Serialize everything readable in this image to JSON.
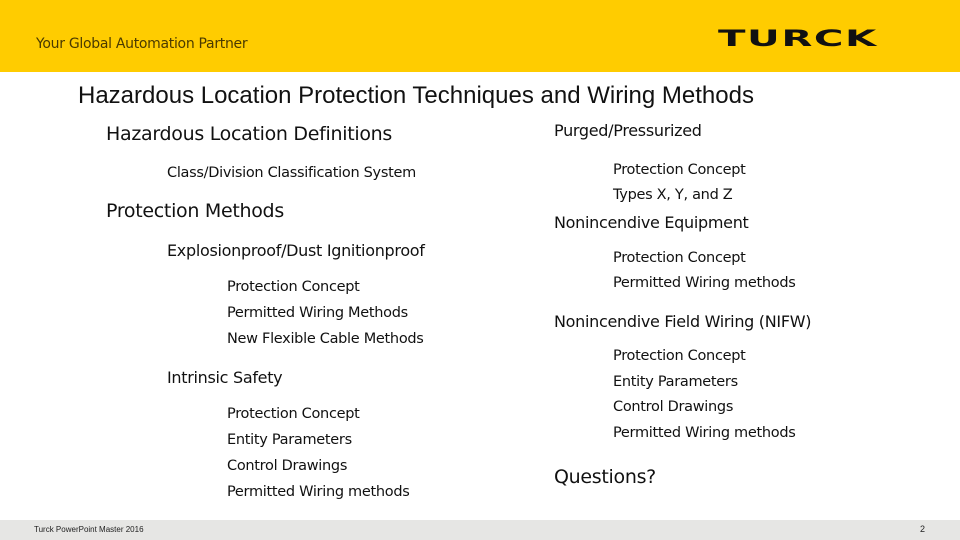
{
  "header": {
    "tagline": "Your Global Automation Partner",
    "logo": "TURCK",
    "brand_color": "#ffcc00"
  },
  "slide": {
    "title": "Hazardous Location Protection Techniques and Wiring Methods",
    "left_column": [
      {
        "level": 1,
        "text": "Hazardous Location Definitions"
      },
      {
        "level": 2,
        "text": "Class/Division Classification System"
      },
      {
        "level": 1,
        "text": "Protection Methods"
      },
      {
        "level": 2,
        "text": "Explosionproof/Dust Ignitionproof"
      },
      {
        "level": 3,
        "text": "Protection Concept"
      },
      {
        "level": 3,
        "text": "Permitted Wiring Methods"
      },
      {
        "level": 3,
        "text": "New Flexible Cable Methods"
      },
      {
        "level": 2,
        "text": "Intrinsic Safety"
      },
      {
        "level": 3,
        "text": "Protection Concept"
      },
      {
        "level": 3,
        "text": "Entity Parameters"
      },
      {
        "level": 3,
        "text": "Control Drawings"
      },
      {
        "level": 3,
        "text": "Permitted Wiring methods"
      }
    ],
    "right_column": [
      {
        "level": 2,
        "text": "Purged/Pressurized"
      },
      {
        "level": 3,
        "text": "Protection Concept"
      },
      {
        "level": 3,
        "text": "Types X, Y, and Z"
      },
      {
        "level": 2,
        "text": "Nonincendive Equipment"
      },
      {
        "level": 3,
        "text": "Protection Concept"
      },
      {
        "level": 3,
        "text": "Permitted Wiring methods"
      },
      {
        "level": 2,
        "text": "Nonincendive Field Wiring (NIFW)"
      },
      {
        "level": 3,
        "text": "Protection Concept"
      },
      {
        "level": 3,
        "text": "Entity Parameters"
      },
      {
        "level": 3,
        "text": "Control Drawings"
      },
      {
        "level": 3,
        "text": "Permitted Wiring methods"
      },
      {
        "level": 1,
        "text": "Questions?"
      }
    ]
  },
  "footer": {
    "text": "Turck PowerPoint Master 2016",
    "page_number": "2"
  }
}
